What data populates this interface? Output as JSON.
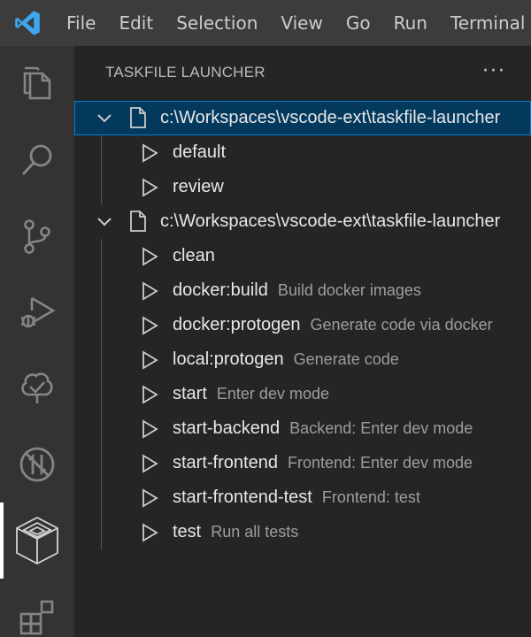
{
  "menubar": {
    "items": [
      "File",
      "Edit",
      "Selection",
      "View",
      "Go",
      "Run",
      "Terminal"
    ]
  },
  "activitybar": {
    "items": [
      {
        "icon": "explorer-icon"
      },
      {
        "icon": "search-icon"
      },
      {
        "icon": "source-control-icon"
      },
      {
        "icon": "run-debug-icon"
      },
      {
        "icon": "tree-check-icon"
      },
      {
        "icon": "no-sync-icon"
      },
      {
        "icon": "taskfile-icon",
        "active": true
      },
      {
        "icon": "extensions-icon"
      }
    ]
  },
  "sidebar": {
    "title": "TASKFILE LAUNCHER",
    "more": "···",
    "folders": [
      {
        "path": "c:\\Workspaces\\vscode-ext\\taskfile-launcher",
        "selected": true,
        "tasks": [
          {
            "name": "default",
            "desc": ""
          },
          {
            "name": "review",
            "desc": ""
          }
        ]
      },
      {
        "path": "c:\\Workspaces\\vscode-ext\\taskfile-launcher",
        "selected": false,
        "tasks": [
          {
            "name": "clean",
            "desc": ""
          },
          {
            "name": "docker:build",
            "desc": "Build docker images"
          },
          {
            "name": "docker:protogen",
            "desc": "Generate code via docker"
          },
          {
            "name": "local:protogen",
            "desc": "Generate code"
          },
          {
            "name": "start",
            "desc": "Enter dev mode"
          },
          {
            "name": "start-backend",
            "desc": "Backend: Enter dev mode"
          },
          {
            "name": "start-frontend",
            "desc": "Frontend: Enter dev mode"
          },
          {
            "name": "start-frontend-test",
            "desc": "Frontend: test"
          },
          {
            "name": "test",
            "desc": "Run all tests"
          }
        ]
      }
    ]
  },
  "colors": {
    "accent": "#007fd4",
    "selection": "#04395e",
    "vscode_blue": "#3ea6f0"
  }
}
